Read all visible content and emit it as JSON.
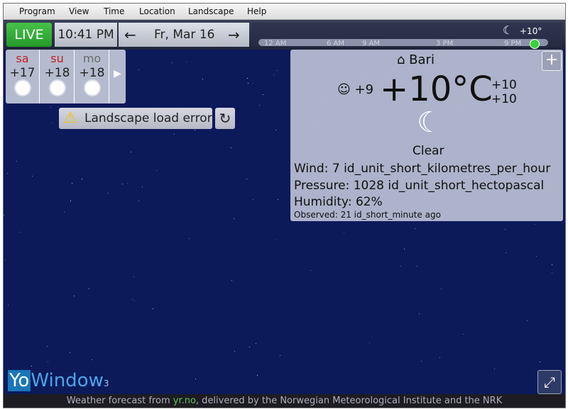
{
  "menu": [
    "Program",
    "View",
    "Time",
    "Location",
    "Landscape",
    "Help"
  ],
  "topbar": {
    "live_label": "LIVE",
    "time": "10:41 PM",
    "prev_arrow": "←",
    "date": "Fr, Mar 16",
    "next_arrow": "→"
  },
  "timeline": {
    "ticks": [
      "12 AM",
      "6 AM",
      "9 AM",
      "3 PM",
      "9 PM"
    ],
    "temp": "+10°"
  },
  "forecast": [
    {
      "day": "sa",
      "temp": "+17",
      "color": "#c01f1f"
    },
    {
      "day": "su",
      "temp": "+18",
      "color": "#c01f1f"
    },
    {
      "day": "mo",
      "temp": "+18",
      "color": "#6b6b6b"
    }
  ],
  "error": {
    "text": "Landscape load error"
  },
  "weather": {
    "location": "Bari",
    "feels_like": "+9",
    "temperature": "+10°C",
    "high": "+10",
    "low": "+10",
    "condition": "Clear",
    "wind": "Wind:  7 id_unit_short_kilometres_per_hour",
    "pressure": "Pressure:  1028 id_unit_short_hectopascal",
    "humidity": "Humidity:  62%",
    "observed": "Observed:  21 id_short_minute ago"
  },
  "logo": {
    "yo": "Yo",
    "window": "Window",
    "version": "3"
  },
  "footer": {
    "prefix": "Weather forecast from ",
    "link": "yr.no",
    "suffix": ", delivered by the Norwegian Meteorological Institute and the NRK"
  }
}
